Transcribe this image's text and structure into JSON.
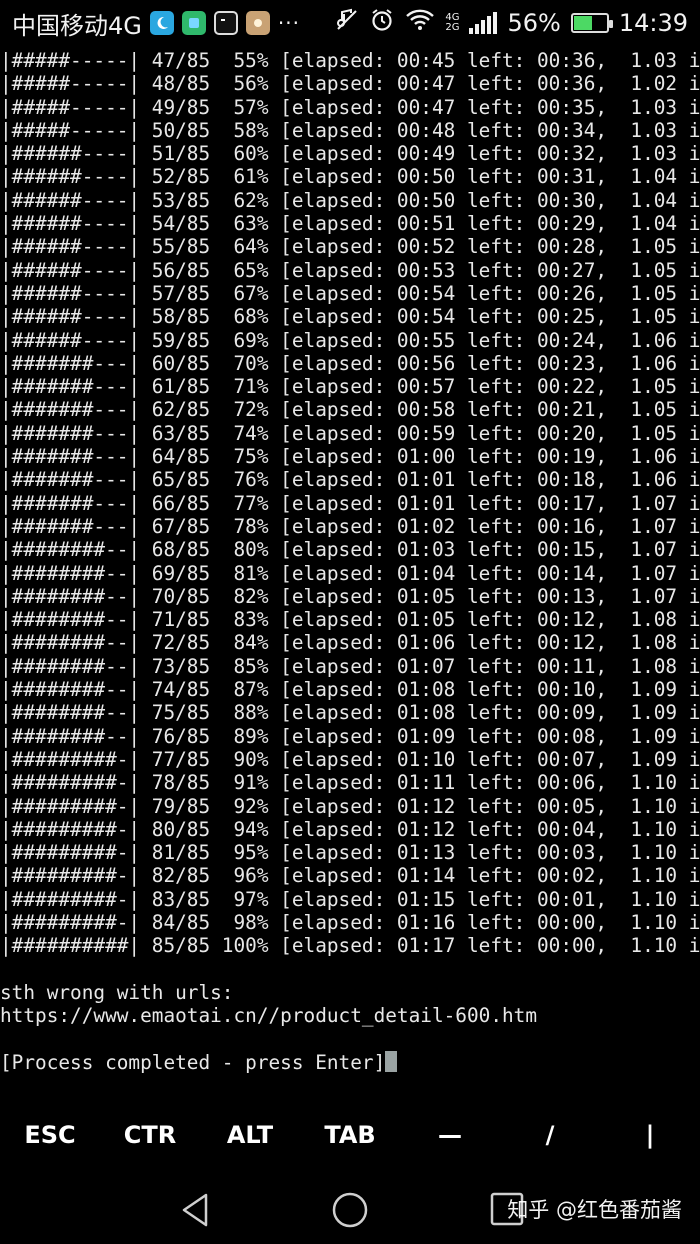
{
  "status_bar": {
    "carrier": "中国移动4G",
    "more": "···",
    "network_top": "4G",
    "network_bottom": "2G",
    "battery": "56%",
    "battery_level": 0.56,
    "time": "14:39",
    "icons": [
      "moon-app-icon",
      "green-app-icon",
      "terminal-app-icon",
      "gallery-app-icon",
      "mute-icon",
      "alarm-icon",
      "wifi-icon",
      "signal-icon",
      "battery-icon"
    ]
  },
  "terminal": {
    "lines": [
      "|#####-----| 47/85  55% [elapsed: 00:45 left: 00:36,  1.03 i",
      "|#####-----| 48/85  56% [elapsed: 00:47 left: 00:36,  1.02 i",
      "|#####-----| 49/85  57% [elapsed: 00:47 left: 00:35,  1.03 i",
      "|#####-----| 50/85  58% [elapsed: 00:48 left: 00:34,  1.03 i",
      "|######----| 51/85  60% [elapsed: 00:49 left: 00:32,  1.03 i",
      "|######----| 52/85  61% [elapsed: 00:50 left: 00:31,  1.04 i",
      "|######----| 53/85  62% [elapsed: 00:50 left: 00:30,  1.04 i",
      "|######----| 54/85  63% [elapsed: 00:51 left: 00:29,  1.04 i",
      "|######----| 55/85  64% [elapsed: 00:52 left: 00:28,  1.05 i",
      "|######----| 56/85  65% [elapsed: 00:53 left: 00:27,  1.05 i",
      "|######----| 57/85  67% [elapsed: 00:54 left: 00:26,  1.05 i",
      "|######----| 58/85  68% [elapsed: 00:54 left: 00:25,  1.05 i",
      "|######----| 59/85  69% [elapsed: 00:55 left: 00:24,  1.06 i",
      "|#######---| 60/85  70% [elapsed: 00:56 left: 00:23,  1.06 i",
      "|#######---| 61/85  71% [elapsed: 00:57 left: 00:22,  1.05 i",
      "|#######---| 62/85  72% [elapsed: 00:58 left: 00:21,  1.05 i",
      "|#######---| 63/85  74% [elapsed: 00:59 left: 00:20,  1.05 i",
      "|#######---| 64/85  75% [elapsed: 01:00 left: 00:19,  1.06 i",
      "|#######---| 65/85  76% [elapsed: 01:01 left: 00:18,  1.06 i",
      "|#######---| 66/85  77% [elapsed: 01:01 left: 00:17,  1.07 i",
      "|#######---| 67/85  78% [elapsed: 01:02 left: 00:16,  1.07 i",
      "|########--| 68/85  80% [elapsed: 01:03 left: 00:15,  1.07 i",
      "|########--| 69/85  81% [elapsed: 01:04 left: 00:14,  1.07 i",
      "|########--| 70/85  82% [elapsed: 01:05 left: 00:13,  1.07 i",
      "|########--| 71/85  83% [elapsed: 01:05 left: 00:12,  1.08 i",
      "|########--| 72/85  84% [elapsed: 01:06 left: 00:12,  1.08 i",
      "|########--| 73/85  85% [elapsed: 01:07 left: 00:11,  1.08 i",
      "|########--| 74/85  87% [elapsed: 01:08 left: 00:10,  1.09 i",
      "|########--| 75/85  88% [elapsed: 01:08 left: 00:09,  1.09 i",
      "|########--| 76/85  89% [elapsed: 01:09 left: 00:08,  1.09 i",
      "|#########-| 77/85  90% [elapsed: 01:10 left: 00:07,  1.09 i",
      "|#########-| 78/85  91% [elapsed: 01:11 left: 00:06,  1.10 i",
      "|#########-| 79/85  92% [elapsed: 01:12 left: 00:05,  1.10 i",
      "|#########-| 80/85  94% [elapsed: 01:12 left: 00:04,  1.10 i",
      "|#########-| 81/85  95% [elapsed: 01:13 left: 00:03,  1.10 i",
      "|#########-| 82/85  96% [elapsed: 01:14 left: 00:02,  1.10 i",
      "|#########-| 83/85  97% [elapsed: 01:15 left: 00:01,  1.10 i",
      "|#########-| 84/85  98% [elapsed: 01:16 left: 00:00,  1.10 i",
      "|##########| 85/85 100% [elapsed: 01:17 left: 00:00,  1.10 i",
      "",
      "sth wrong with urls:",
      "https://www.emaotai.cn//product_detail-600.htm",
      ""
    ],
    "prompt": "[Process completed - press Enter]",
    "colors": {
      "background": "#000000",
      "foreground": "#e8e8e8",
      "cursor": "#9aa3a3"
    }
  },
  "extra_keys": [
    {
      "label": "ESC"
    },
    {
      "label": "CTR"
    },
    {
      "label": "ALT"
    },
    {
      "label": "TAB"
    },
    {
      "label": "—"
    },
    {
      "label": "/"
    },
    {
      "label": "|"
    }
  ],
  "nav_bar": {
    "watermark": "知乎 @红色番茄酱",
    "icons": [
      "back-icon",
      "home-icon",
      "recents-icon"
    ]
  }
}
